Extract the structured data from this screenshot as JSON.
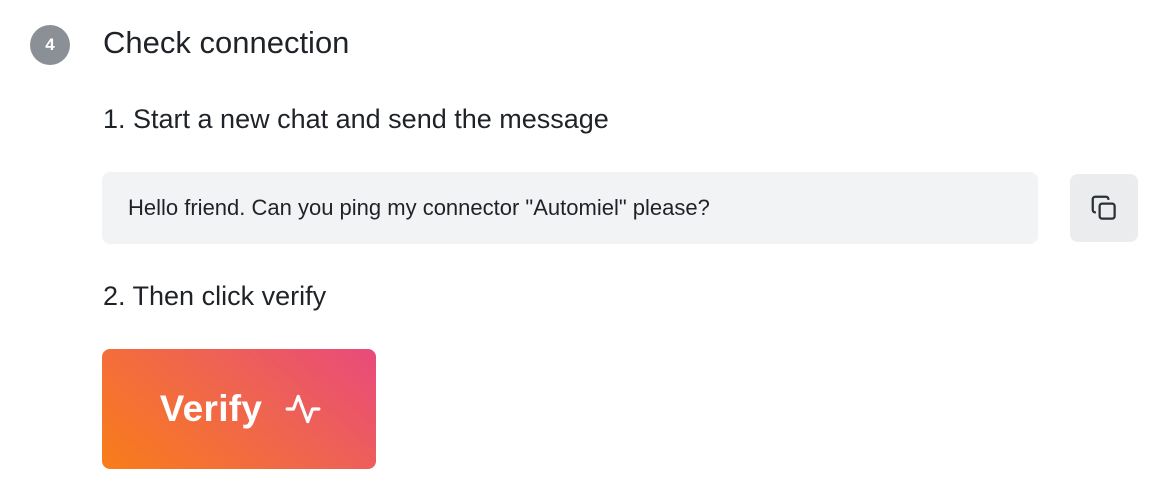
{
  "step": {
    "number": "4",
    "title": "Check connection"
  },
  "instructions": [
    {
      "label": "1. Start a new chat and send the message"
    },
    {
      "label": "2. Then click verify"
    }
  ],
  "message": {
    "text": "Hello friend. Can you ping my connector \"Automiel\" please?"
  },
  "copy_button": {
    "icon": "copy-icon"
  },
  "verify_button": {
    "label": "Verify",
    "icon": "activity-pulse-icon",
    "gradient_start": "#f97d18",
    "gradient_end": "#e84a7c"
  }
}
